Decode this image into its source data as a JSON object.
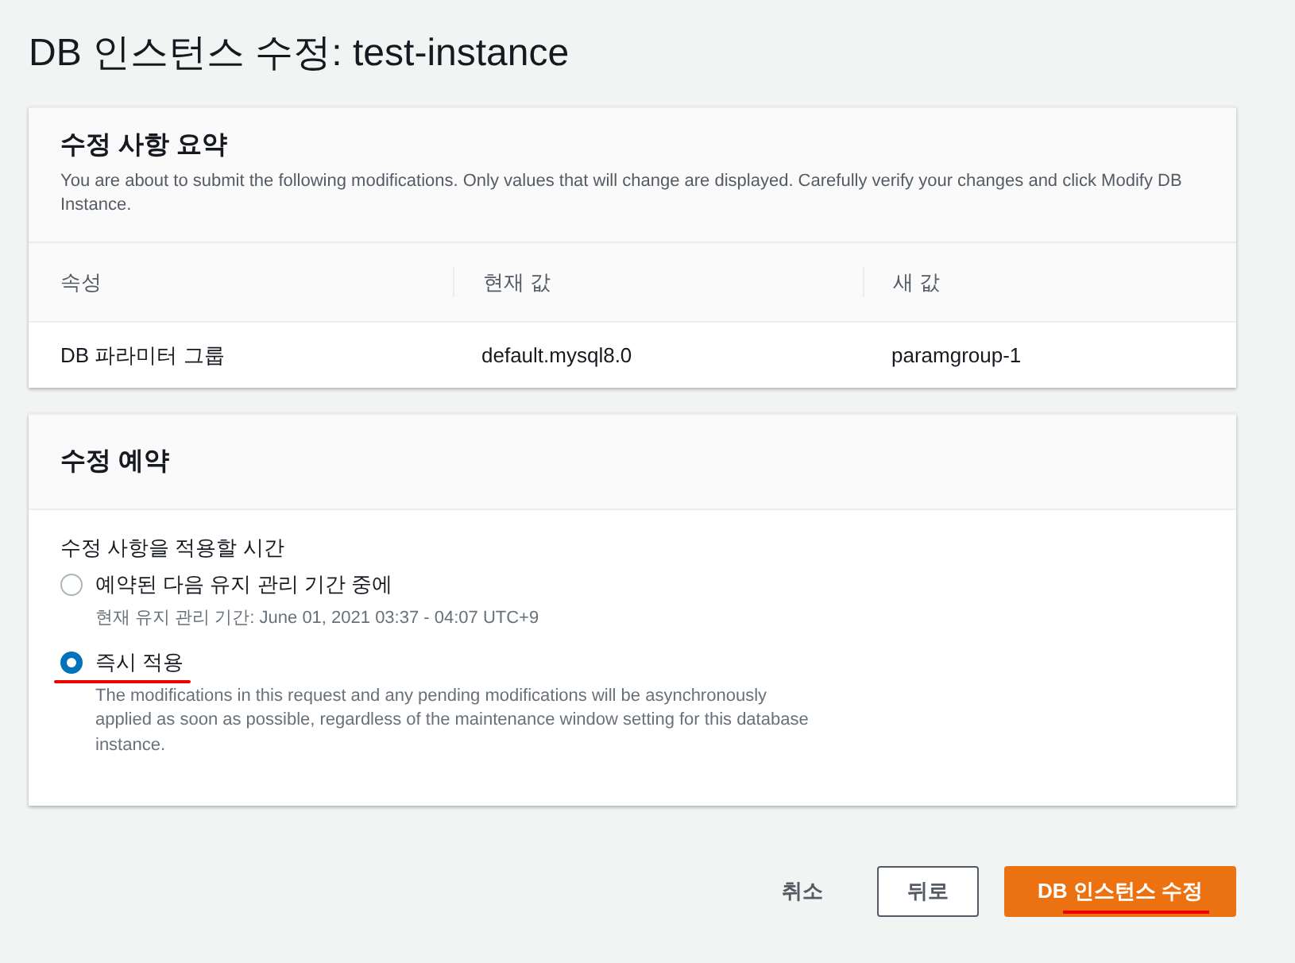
{
  "title": "DB 인스턴스 수정: test-instance",
  "summary": {
    "heading": "수정 사항 요약",
    "description": "You are about to submit the following modifications. Only values that will change are displayed. Carefully verify your changes and click Modify DB Instance.",
    "columns": [
      "속성",
      "현재 값",
      "새 값"
    ],
    "rows": [
      [
        "DB 파라미터 그룹",
        "default.mysql8.0",
        "paramgroup-1"
      ]
    ]
  },
  "schedule": {
    "heading": "수정 예약",
    "question": "수정 사항을 적용할 시간",
    "options": [
      {
        "label": "예약된 다음 유지 관리 기간 중에",
        "detail": "현재 유지 관리 기간: June 01, 2021 03:37 - 04:07 UTC+9",
        "selected": false,
        "annotated": false
      },
      {
        "label": "즉시 적용",
        "detail": "The modifications in this request and any pending modifications will be asynchronously applied as soon as possible, regardless of the maintenance window setting for this database instance.",
        "selected": true,
        "annotated": true
      }
    ]
  },
  "buttons": [
    {
      "kind": "link",
      "label": "취소",
      "annotated": false
    },
    {
      "kind": "outline",
      "label": "뒤로",
      "annotated": false
    },
    {
      "kind": "primary",
      "label": "DB 인스턴스 수정",
      "annotated": true
    }
  ]
}
